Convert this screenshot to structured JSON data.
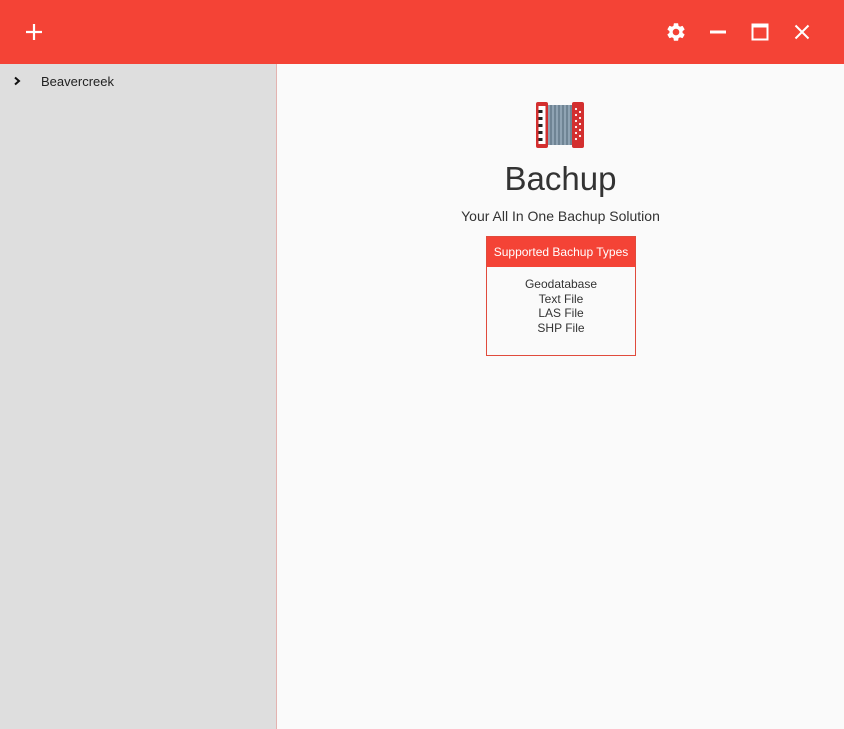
{
  "titlebar": {
    "bg_color": "#f44336",
    "add_icon": "plus-icon",
    "settings_icon": "gear-icon",
    "minimize_icon": "minimize-icon",
    "maximize_icon": "maximize-icon",
    "close_icon": "close-icon"
  },
  "sidebar": {
    "items": [
      {
        "label": "Beavercreek",
        "icon": "chevron-right-icon"
      }
    ]
  },
  "main": {
    "logo_icon": "accordion-icon",
    "title": "Bachup",
    "subtitle": "Your All In One Bachup Solution",
    "types_card": {
      "header": "Supported Bachup Types",
      "items": [
        "Geodatabase",
        "Text File",
        "LAS File",
        "SHP File"
      ]
    }
  },
  "colors": {
    "accent": "#f44336",
    "sidebar_bg": "#dedede",
    "main_bg": "#fafafa"
  }
}
